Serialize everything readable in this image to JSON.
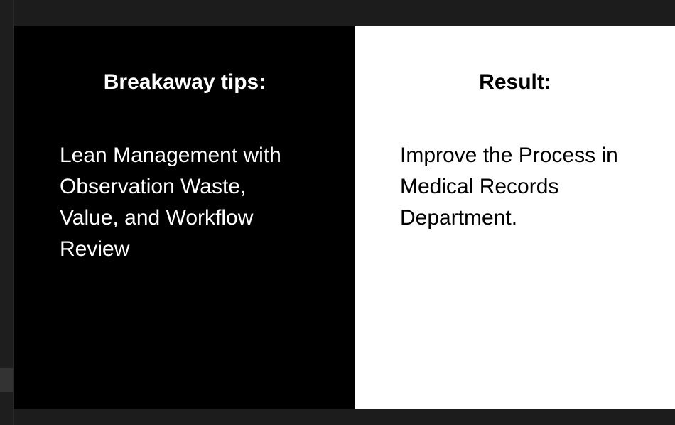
{
  "slide": {
    "left_panel": {
      "heading": "Breakaway tips:",
      "lines": [
        "Lean Management with",
        "Observation Waste,",
        "Value, and Workflow",
        "Review"
      ]
    },
    "right_panel": {
      "heading": "Result:",
      "lines": [
        "Improve the Process in",
        "Medical Records",
        "Department."
      ]
    }
  },
  "colors": {
    "left_bg": "#000000",
    "right_bg": "#ffffff",
    "frame": "#1b1b1b"
  }
}
